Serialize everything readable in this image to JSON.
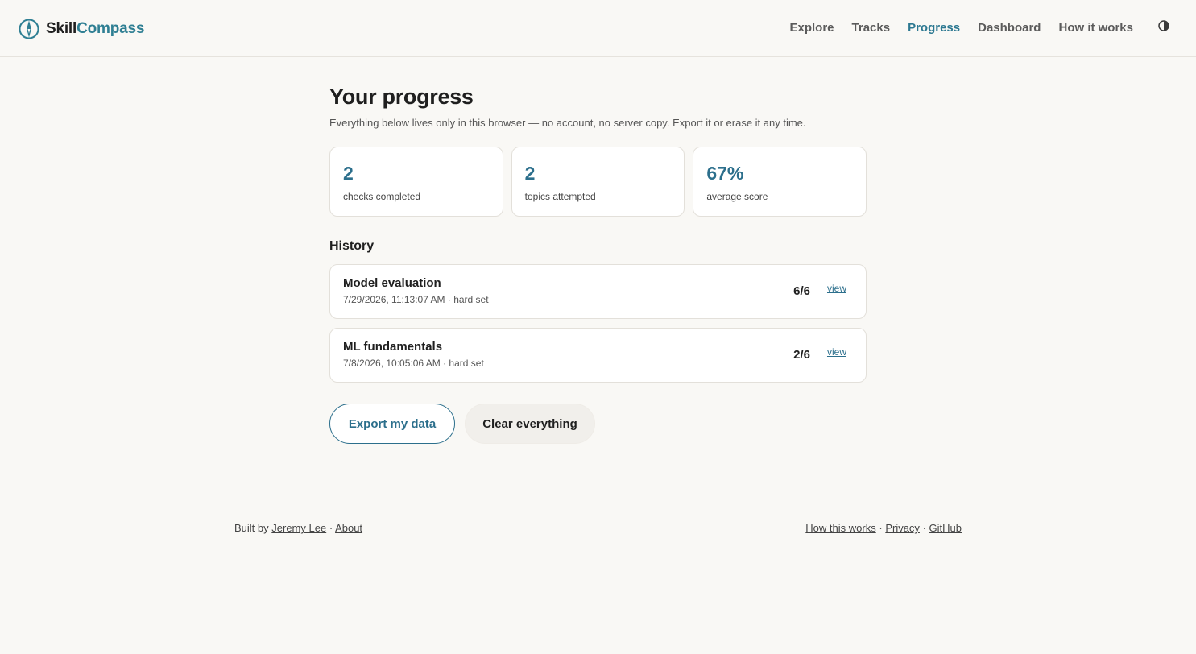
{
  "header": {
    "brand_part1": "Skill",
    "brand_part2": "Compass",
    "brand_color": "#2f7f93",
    "logo_icon": "compass-icon",
    "theme_icon": "contrast-icon",
    "nav": [
      {
        "label": "Explore",
        "active": false
      },
      {
        "label": "Tracks",
        "active": false
      },
      {
        "label": "Progress",
        "active": true
      },
      {
        "label": "Dashboard",
        "active": false
      },
      {
        "label": "How it works",
        "active": false
      }
    ]
  },
  "main": {
    "title": "Your progress",
    "subtitle": "Everything below lives only in this browser — no account, no server copy. Export it or erase it any time.",
    "stats": [
      {
        "value": "2",
        "label": "checks completed"
      },
      {
        "value": "2",
        "label": "topics attempted"
      },
      {
        "value": "67%",
        "label": "average score"
      }
    ],
    "history_title": "History",
    "history": [
      {
        "title": "Model evaluation",
        "meta": "7/29/2026, 11:13:07 AM · hard set",
        "score": "6/6",
        "link": "view"
      },
      {
        "title": "ML fundamentals",
        "meta": "7/8/2026, 10:05:06 AM · hard set",
        "score": "2/6",
        "link": "view"
      }
    ],
    "export_label": "Export my data",
    "clear_label": "Clear everything"
  },
  "footer": {
    "built_by": "Built by",
    "author": "Jeremy Lee",
    "sep": "·",
    "about": "About",
    "how": "How this works",
    "privacy": "Privacy",
    "github": "GitHub"
  },
  "colors": {
    "accent": "#2c6f8c",
    "background": "#f9f8f5"
  }
}
